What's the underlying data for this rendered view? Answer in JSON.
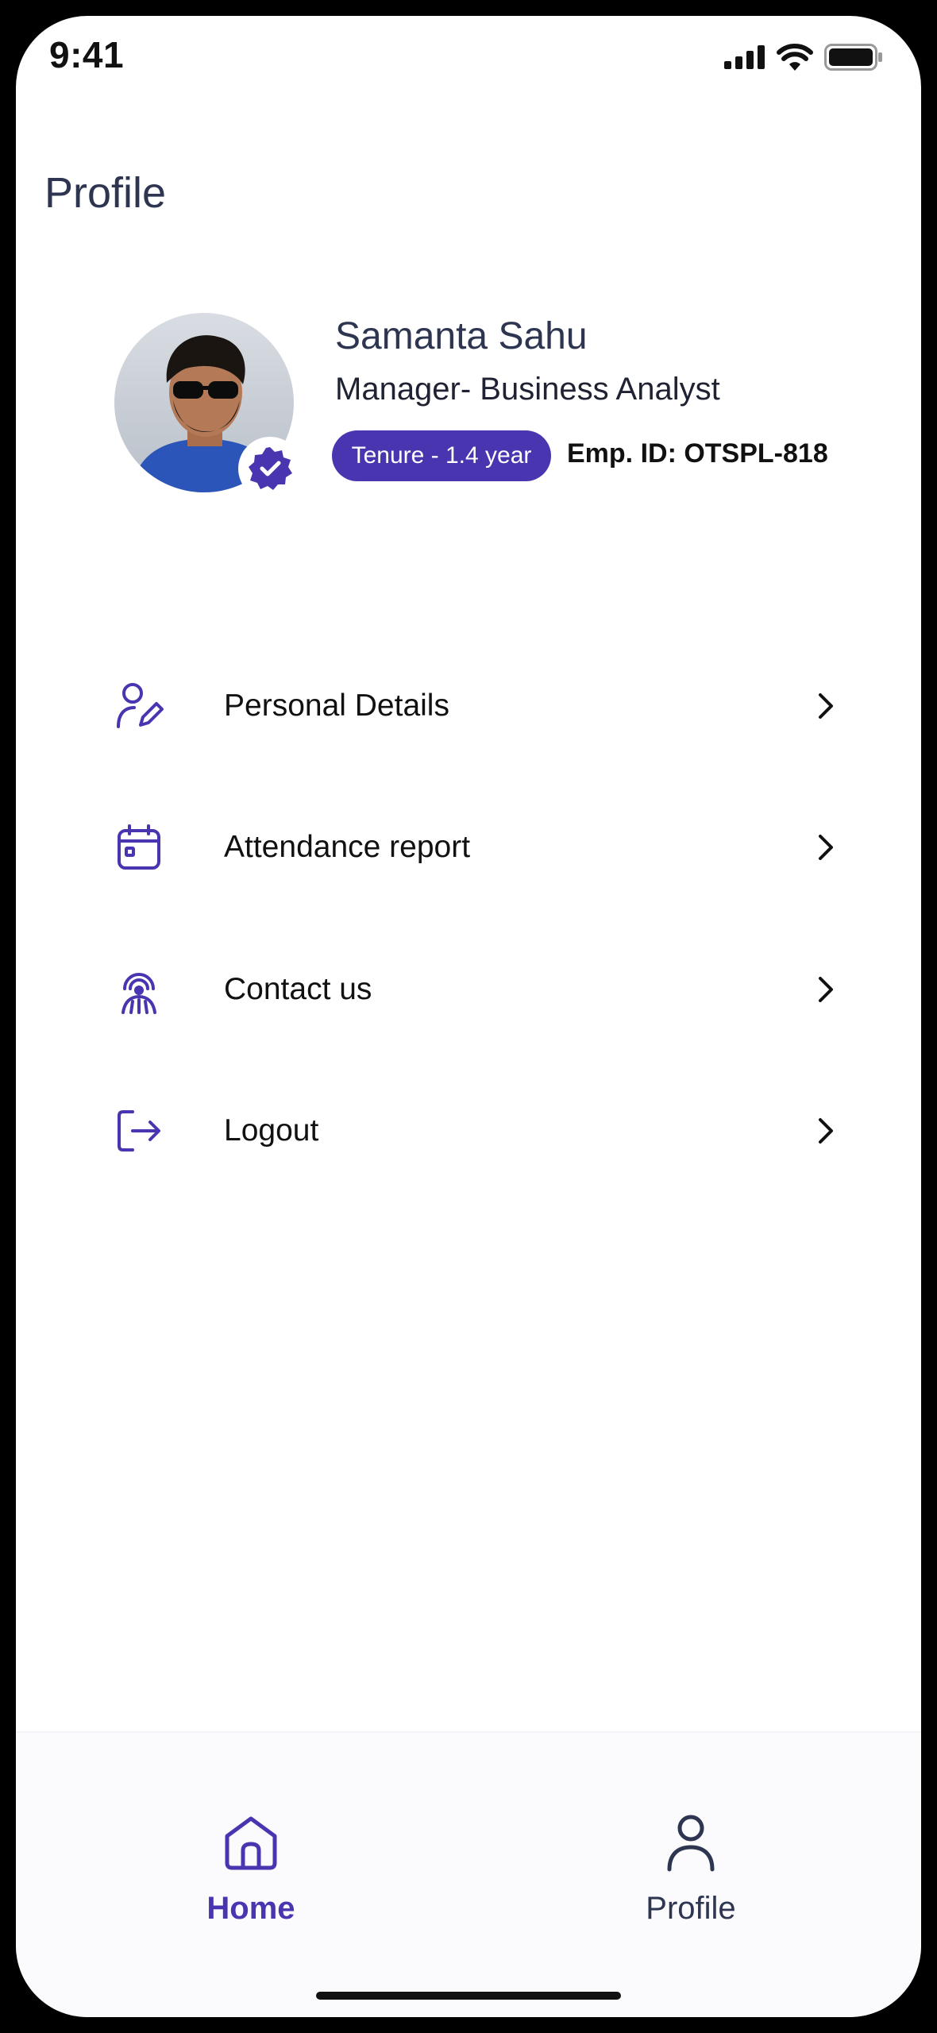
{
  "status_bar": {
    "time": "9:41"
  },
  "header": {
    "title": "Profile"
  },
  "profile": {
    "name": "Samanta Sahu",
    "role": "Manager- Business Analyst",
    "tenure": "Tenure - 1.4 year",
    "emp_id": "Emp. ID: OTSPL-818"
  },
  "menu": {
    "items": [
      {
        "label": "Personal Details",
        "icon": "user-edit-icon"
      },
      {
        "label": "Attendance report",
        "icon": "calendar-icon"
      },
      {
        "label": "Contact us",
        "icon": "support-agent-icon"
      },
      {
        "label": "Logout",
        "icon": "logout-icon"
      }
    ]
  },
  "bottom_nav": {
    "tabs": [
      {
        "label": "Home",
        "icon": "home-icon",
        "active": true
      },
      {
        "label": "Profile",
        "icon": "person-icon",
        "active": false
      }
    ]
  },
  "colors": {
    "accent": "#4a35b0",
    "title_text": "#2e3550",
    "inactive_nav": "#2e3550"
  }
}
